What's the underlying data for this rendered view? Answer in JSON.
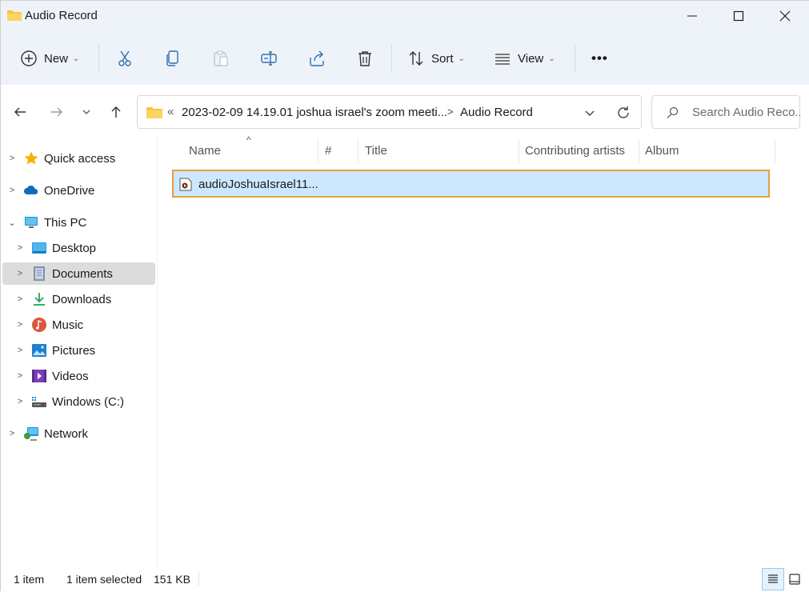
{
  "window": {
    "title": "Audio Record",
    "controls": [
      "minimize",
      "maximize",
      "close"
    ]
  },
  "toolbar": {
    "new_label": "New",
    "sort_label": "Sort",
    "view_label": "View",
    "more_label": "•••",
    "icons": [
      "cut-icon",
      "copy-icon",
      "paste-icon",
      "rename-icon",
      "share-icon",
      "delete-icon"
    ]
  },
  "address": {
    "overflow": "«",
    "crumbs": [
      "2023-02-09 14.19.01 joshua israel's zoom meeti...",
      "Audio Record"
    ],
    "separator": ">"
  },
  "search": {
    "placeholder": "Search Audio Reco..."
  },
  "sidebar": {
    "items": [
      {
        "label": "Quick access",
        "icon": "star-icon",
        "expanded": false
      },
      {
        "label": "OneDrive",
        "icon": "cloud-icon",
        "expanded": false
      },
      {
        "label": "This PC",
        "icon": "computer-icon",
        "expanded": true
      },
      {
        "label": "Desktop",
        "icon": "desktop-icon",
        "expanded": false
      },
      {
        "label": "Documents",
        "icon": "documents-icon",
        "expanded": false,
        "selected": true
      },
      {
        "label": "Downloads",
        "icon": "download-icon",
        "expanded": false
      },
      {
        "label": "Music",
        "icon": "music-icon",
        "expanded": false
      },
      {
        "label": "Pictures",
        "icon": "pictures-icon",
        "expanded": false
      },
      {
        "label": "Videos",
        "icon": "videos-icon",
        "expanded": false
      },
      {
        "label": "Windows (C:)",
        "icon": "drive-icon",
        "expanded": false
      },
      {
        "label": "Network",
        "icon": "network-icon",
        "expanded": false
      }
    ]
  },
  "filelist": {
    "columns": [
      "Name",
      "#",
      "Title",
      "Contributing artists",
      "Album"
    ],
    "sort_indicator": "^",
    "files": [
      {
        "name": "audioJoshuaIsrael11...",
        "selected": true
      }
    ]
  },
  "status": {
    "item_count": "1 item",
    "selection": "1 item selected",
    "size": "151 KB"
  },
  "colors": {
    "accent": "#0078d4",
    "selected_row": "#cce8ff",
    "focus_border": "#e5a13a",
    "toolbar_bg": "#eef3f9"
  }
}
